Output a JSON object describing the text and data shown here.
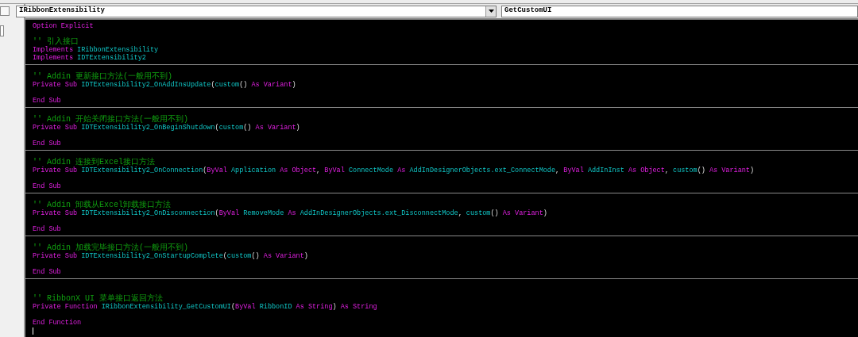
{
  "object_box": {
    "value": "IRibbonExtensibility"
  },
  "procedure_box": {
    "value": "GetCustomUI"
  },
  "sections": [
    {
      "lines": [
        {
          "tokens": [
            {
              "kind": "keyword",
              "text": "Option Explicit"
            }
          ]
        },
        {
          "kind": "blank"
        },
        {
          "tokens": [
            {
              "kind": "comment",
              "text": "'' 引入接口"
            }
          ]
        },
        {
          "tokens": [
            {
              "kind": "keyword",
              "text": "Implements"
            },
            {
              "kind": "ident",
              "text": " IRibbonExtensibility"
            }
          ]
        },
        {
          "tokens": [
            {
              "kind": "keyword",
              "text": "Implements"
            },
            {
              "kind": "ident",
              "text": " IDTExtensibility2"
            }
          ]
        }
      ]
    },
    {
      "lines": [
        {
          "kind": "blank"
        },
        {
          "tokens": [
            {
              "kind": "comment",
              "text": "'' Addin 更新接口方法(一般用不到)"
            }
          ]
        },
        {
          "tokens": [
            {
              "kind": "keyword",
              "text": "Private Sub"
            },
            {
              "kind": "ident",
              "text": " IDTExtensibility2_OnAddInsUpdate"
            },
            {
              "kind": "plain",
              "text": "("
            },
            {
              "kind": "ident",
              "text": "custom"
            },
            {
              "kind": "plain",
              "text": "() "
            },
            {
              "kind": "keyword",
              "text": "As Variant"
            },
            {
              "kind": "plain",
              "text": ")"
            }
          ]
        },
        {
          "kind": "blank"
        },
        {
          "tokens": [
            {
              "kind": "keyword",
              "text": "End Sub"
            }
          ]
        }
      ]
    },
    {
      "lines": [
        {
          "kind": "blank"
        },
        {
          "tokens": [
            {
              "kind": "comment",
              "text": "'' Addin 开始关闭接口方法(一般用不到)"
            }
          ]
        },
        {
          "tokens": [
            {
              "kind": "keyword",
              "text": "Private Sub"
            },
            {
              "kind": "ident",
              "text": " IDTExtensibility2_OnBeginShutdown"
            },
            {
              "kind": "plain",
              "text": "("
            },
            {
              "kind": "ident",
              "text": "custom"
            },
            {
              "kind": "plain",
              "text": "() "
            },
            {
              "kind": "keyword",
              "text": "As Variant"
            },
            {
              "kind": "plain",
              "text": ")"
            }
          ]
        },
        {
          "kind": "blank"
        },
        {
          "tokens": [
            {
              "kind": "keyword",
              "text": "End Sub"
            }
          ]
        }
      ]
    },
    {
      "lines": [
        {
          "kind": "blank"
        },
        {
          "tokens": [
            {
              "kind": "comment",
              "text": "'' Addin 连接到Excel接口方法"
            }
          ]
        },
        {
          "tokens": [
            {
              "kind": "keyword",
              "text": "Private Sub"
            },
            {
              "kind": "ident",
              "text": " IDTExtensibility2_OnConnection"
            },
            {
              "kind": "plain",
              "text": "("
            },
            {
              "kind": "keyword",
              "text": "ByVal"
            },
            {
              "kind": "ident",
              "text": " Application "
            },
            {
              "kind": "keyword",
              "text": "As Object"
            },
            {
              "kind": "plain",
              "text": ", "
            },
            {
              "kind": "keyword",
              "text": "ByVal"
            },
            {
              "kind": "ident",
              "text": " ConnectMode "
            },
            {
              "kind": "keyword",
              "text": "As"
            },
            {
              "kind": "ident",
              "text": " AddInDesignerObjects.ext_ConnectMode"
            },
            {
              "kind": "plain",
              "text": ", "
            },
            {
              "kind": "keyword",
              "text": "ByVal"
            },
            {
              "kind": "ident",
              "text": " AddInInst "
            },
            {
              "kind": "keyword",
              "text": "As Object"
            },
            {
              "kind": "plain",
              "text": ", "
            },
            {
              "kind": "ident",
              "text": "custom"
            },
            {
              "kind": "plain",
              "text": "() "
            },
            {
              "kind": "keyword",
              "text": "As Variant"
            },
            {
              "kind": "plain",
              "text": ")"
            }
          ]
        },
        {
          "kind": "blank"
        },
        {
          "tokens": [
            {
              "kind": "keyword",
              "text": "End Sub"
            }
          ]
        }
      ]
    },
    {
      "lines": [
        {
          "kind": "blank"
        },
        {
          "tokens": [
            {
              "kind": "comment",
              "text": "'' Addin 卸载从Excel卸载接口方法"
            }
          ]
        },
        {
          "tokens": [
            {
              "kind": "keyword",
              "text": "Private Sub"
            },
            {
              "kind": "ident",
              "text": " IDTExtensibility2_OnDisconnection"
            },
            {
              "kind": "plain",
              "text": "("
            },
            {
              "kind": "keyword",
              "text": "ByVal"
            },
            {
              "kind": "ident",
              "text": " RemoveMode "
            },
            {
              "kind": "keyword",
              "text": "As"
            },
            {
              "kind": "ident",
              "text": " AddInDesignerObjects.ext_DisconnectMode"
            },
            {
              "kind": "plain",
              "text": ", "
            },
            {
              "kind": "ident",
              "text": "custom"
            },
            {
              "kind": "plain",
              "text": "() "
            },
            {
              "kind": "keyword",
              "text": "As Variant"
            },
            {
              "kind": "plain",
              "text": ")"
            }
          ]
        },
        {
          "kind": "blank"
        },
        {
          "tokens": [
            {
              "kind": "keyword",
              "text": "End Sub"
            }
          ]
        }
      ]
    },
    {
      "lines": [
        {
          "kind": "blank"
        },
        {
          "tokens": [
            {
              "kind": "comment",
              "text": "'' Addin 加载完毕接口方法(一般用不到)"
            }
          ]
        },
        {
          "tokens": [
            {
              "kind": "keyword",
              "text": "Private Sub"
            },
            {
              "kind": "ident",
              "text": " IDTExtensibility2_OnStartupComplete"
            },
            {
              "kind": "plain",
              "text": "("
            },
            {
              "kind": "ident",
              "text": "custom"
            },
            {
              "kind": "plain",
              "text": "() "
            },
            {
              "kind": "keyword",
              "text": "As Variant"
            },
            {
              "kind": "plain",
              "text": ")"
            }
          ]
        },
        {
          "kind": "blank"
        },
        {
          "tokens": [
            {
              "kind": "keyword",
              "text": "End Sub"
            }
          ]
        }
      ]
    },
    {
      "lines": [
        {
          "kind": "blank"
        },
        {
          "kind": "blank"
        },
        {
          "tokens": [
            {
              "kind": "comment",
              "text": "'' RibbonX UI 菜单接口返回方法"
            }
          ]
        },
        {
          "tokens": [
            {
              "kind": "keyword",
              "text": "Private Function"
            },
            {
              "kind": "ident",
              "text": " IRibbonExtensibility_GetCustomUI"
            },
            {
              "kind": "plain",
              "text": "("
            },
            {
              "kind": "keyword",
              "text": "ByVal"
            },
            {
              "kind": "ident",
              "text": " RibbonID "
            },
            {
              "kind": "keyword",
              "text": "As String"
            },
            {
              "kind": "plain",
              "text": ") "
            },
            {
              "kind": "keyword",
              "text": "As String"
            }
          ]
        },
        {
          "kind": "blank"
        },
        {
          "tokens": [
            {
              "kind": "keyword",
              "text": "End Function"
            }
          ]
        },
        {
          "kind": "cursor"
        }
      ]
    }
  ]
}
